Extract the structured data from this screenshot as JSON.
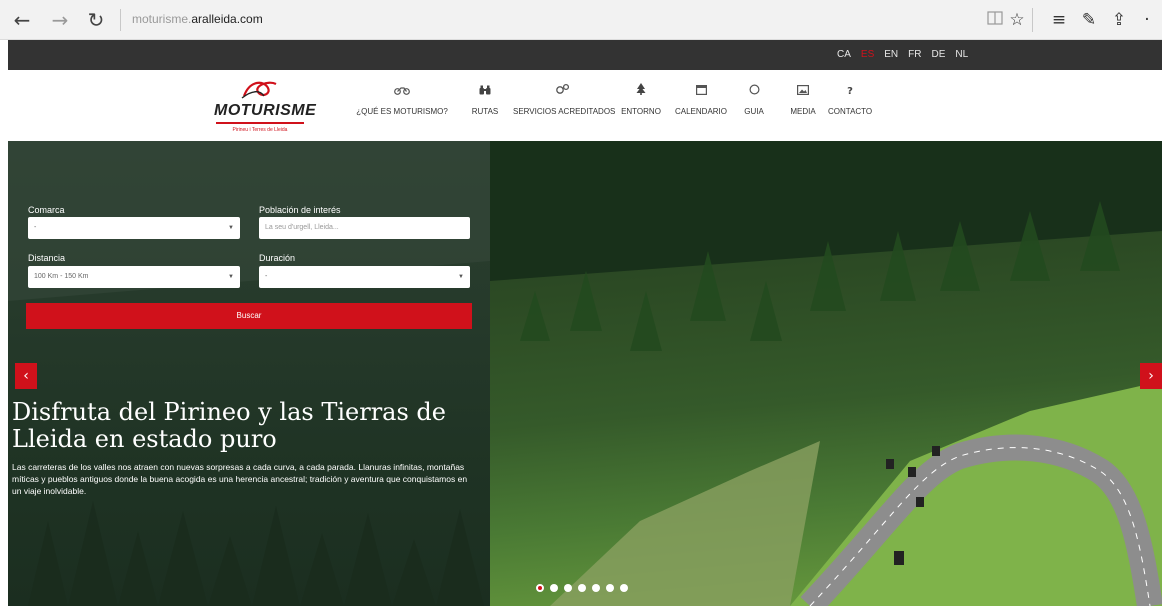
{
  "browser": {
    "back_icon": "←",
    "forward_icon": "→",
    "refresh_icon": "↻",
    "url_prefix": "moturisme.",
    "url_domain": "aralleida.com",
    "tools": [
      "reading-view-icon",
      "favorite-star-icon",
      "hub-icon",
      "web-note-icon",
      "share-icon",
      "more-icon"
    ]
  },
  "languages": {
    "items": [
      "CA",
      "ES",
      "EN",
      "FR",
      "DE",
      "NL"
    ],
    "active": "ES"
  },
  "logo": {
    "brand": "MOTURISME",
    "tagline": "Pirineu i Terres de Lleida"
  },
  "menu": [
    {
      "label": "¿QUÉ ES MOTURISMO?",
      "icon": "motorcycle-icon"
    },
    {
      "label": "RUTAS",
      "icon": "binoculars-icon"
    },
    {
      "label": "SERVICIOS ACREDITADOS",
      "icon": "wrench-icon"
    },
    {
      "label": "ENTORNO",
      "icon": "tree-icon"
    },
    {
      "label": "CALENDARIO",
      "icon": "calendar-icon"
    },
    {
      "label": "GUIA",
      "icon": "circle-icon"
    },
    {
      "label": "MEDIA",
      "icon": "image-icon"
    },
    {
      "label": "CONTACTO",
      "icon": "question-icon"
    }
  ],
  "search": {
    "comarca_label": "Comarca",
    "comarca_value": "-",
    "poblacion_label": "Población de interés",
    "poblacion_placeholder": "La seu d'urgell, Lleida...",
    "distancia_label": "Distancia",
    "distancia_value": "100 Km - 150 Km",
    "duracion_label": "Duración",
    "duracion_value": "-",
    "button_label": "Buscar"
  },
  "hero": {
    "title": "Disfruta del Pirineo y las Tierras de Lleida en estado puro",
    "text": "Las carreteras de los valles nos atraen con nuevas sorpresas a cada curva, a cada parada. Llanuras infinitas, montañas míticas y pueblos antiguos donde la buena acogida es una herencia ancestral; tradición y aventura que conquistamos en un viaje inolvidable.",
    "prev_arrow": "‹",
    "next_arrow": "›",
    "slide_count": 7,
    "active_slide": 1
  },
  "colors": {
    "accent": "#d0111b",
    "topbar": "#333333"
  }
}
